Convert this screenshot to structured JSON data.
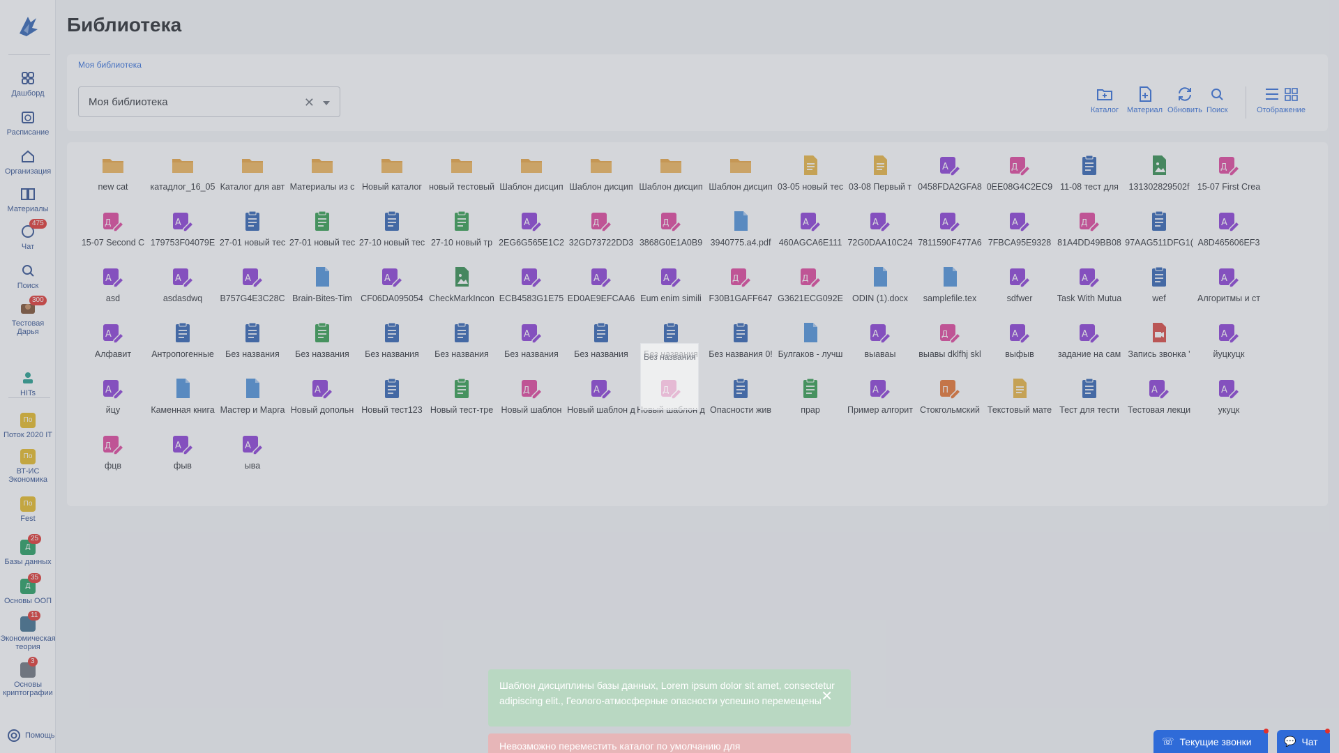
{
  "page_title": "Библиотека",
  "breadcrumb": "Моя библиотека",
  "library_select": {
    "value": "Моя библиотека"
  },
  "toolbar": {
    "catalog": "Каталог",
    "material": "Материал",
    "refresh": "Обновить",
    "search": "Поиск",
    "display": "Отображение"
  },
  "sidebar": {
    "items": [
      {
        "label": "Дашборд",
        "icon": "dashboard-icon"
      },
      {
        "label": "Расписание",
        "icon": "schedule-icon"
      },
      {
        "label": "Организация",
        "icon": "home-icon"
      },
      {
        "label": "Материалы",
        "icon": "book-icon"
      },
      {
        "label": "Чат",
        "icon": "chat-icon",
        "badge": "475"
      },
      {
        "label": "Поиск",
        "icon": "search-icon"
      },
      {
        "label": "Тестовая Дарья",
        "icon": "avatar-icon",
        "badge": "300"
      },
      {
        "label": "HITs",
        "icon": "hits-logo"
      }
    ],
    "courses": [
      {
        "label": "Поток 2020 IT",
        "abbr": "По",
        "color": "#e6b91e"
      },
      {
        "label": "ВТ-ИС Экономика",
        "abbr": "По",
        "color": "#e6b91e"
      },
      {
        "label": "Fest",
        "abbr": "По",
        "color": "#e6b91e"
      },
      {
        "label": "Базы данных",
        "abbr": "Д",
        "color": "#1e9b5a",
        "badge": "25"
      },
      {
        "label": "Основы ООП",
        "abbr": "Д",
        "color": "#1e9b5a",
        "badge": "35"
      },
      {
        "label": "Экономическая теория",
        "abbr": "",
        "color": "#3a6a8a",
        "badge": "11"
      },
      {
        "label": "Основы криптографии",
        "abbr": "",
        "color": "#6b7079",
        "badge": "3"
      }
    ],
    "help": "Помощь"
  },
  "files": [
    {
      "name": "new cat",
      "type": "folder"
    },
    {
      "name": "катадлог_16_05",
      "type": "folder"
    },
    {
      "name": "Каталог для авт",
      "type": "folder"
    },
    {
      "name": "Материалы из с",
      "type": "folder"
    },
    {
      "name": "Новый каталог",
      "type": "folder"
    },
    {
      "name": "новый тестовый",
      "type": "folder"
    },
    {
      "name": "Шаблон дисцип",
      "type": "folder"
    },
    {
      "name": "Шаблон дисцип",
      "type": "folder"
    },
    {
      "name": "Шаблон дисцип",
      "type": "folder"
    },
    {
      "name": "Шаблон дисцип",
      "type": "folder"
    },
    {
      "name": "03-05 новый тес",
      "type": "doc-yellow"
    },
    {
      "name": "03-08 Первый т",
      "type": "doc-yellow"
    },
    {
      "name": "0458FDA2GFA8",
      "type": "task-purple"
    },
    {
      "name": "0EE08G4C2EC9",
      "type": "task-pink"
    },
    {
      "name": "11-08 тест для",
      "type": "test-blue"
    },
    {
      "name": "131302829502f",
      "type": "image-green"
    },
    {
      "name": "15-07 First Crea",
      "type": "task-pink"
    },
    {
      "name": "15-07 Second C",
      "type": "task-pink"
    },
    {
      "name": "179753F04079E",
      "type": "task-purple"
    },
    {
      "name": "27-01 новый тес",
      "type": "test-blue"
    },
    {
      "name": "27-01 новый тес",
      "type": "test-green"
    },
    {
      "name": "27-10 новый тес",
      "type": "test-blue"
    },
    {
      "name": "27-10 новый тр",
      "type": "test-green"
    },
    {
      "name": "2EG6G565E1C2",
      "type": "task-purple"
    },
    {
      "name": "32GD73722DD3",
      "type": "task-pink"
    },
    {
      "name": "3868G0E1A0B9",
      "type": "task-pink"
    },
    {
      "name": "3940775.a4.pdf",
      "type": "file-blue"
    },
    {
      "name": "460AGCA6E111",
      "type": "task-purple"
    },
    {
      "name": "72G0DAA10C24",
      "type": "task-purple"
    },
    {
      "name": "7811590F477A6",
      "type": "task-purple"
    },
    {
      "name": "7FBCA95E9328",
      "type": "task-purple"
    },
    {
      "name": "81A4DD49BB08",
      "type": "task-pink"
    },
    {
      "name": "97AAG511DFG1(",
      "type": "test-blue"
    },
    {
      "name": "A8D465606EF3",
      "type": "task-purple"
    },
    {
      "name": "asd",
      "type": "task-purple"
    },
    {
      "name": "asdasdwq",
      "type": "task-purple"
    },
    {
      "name": "B757G4E3C28C",
      "type": "task-purple"
    },
    {
      "name": "Brain-Bites-Tim",
      "type": "file-blue"
    },
    {
      "name": "CF06DA095054",
      "type": "task-purple"
    },
    {
      "name": "CheckMarkIncon",
      "type": "image-green"
    },
    {
      "name": "ECB4583G1E75",
      "type": "task-purple"
    },
    {
      "name": "ED0AE9EFCAA6",
      "type": "task-purple"
    },
    {
      "name": "Eum enim simili",
      "type": "task-purple"
    },
    {
      "name": "F30B1GAFF647",
      "type": "task-pink"
    },
    {
      "name": "G3621ECG092E",
      "type": "task-pink"
    },
    {
      "name": "ODIN (1).docx",
      "type": "file-blue"
    },
    {
      "name": "samplefile.tex",
      "type": "file-blue"
    },
    {
      "name": "sdfwer",
      "type": "task-purple"
    },
    {
      "name": "Task With Mutua",
      "type": "task-purple"
    },
    {
      "name": "wef",
      "type": "test-blue"
    },
    {
      "name": "Алгоритмы и ст",
      "type": "task-purple"
    },
    {
      "name": "Алфавит",
      "type": "task-purple"
    },
    {
      "name": "Антропогенные",
      "type": "test-blue"
    },
    {
      "name": "Без названия",
      "type": "test-blue"
    },
    {
      "name": "Без названия",
      "type": "test-green"
    },
    {
      "name": "Без названия",
      "type": "test-blue"
    },
    {
      "name": "Без названия",
      "type": "test-blue"
    },
    {
      "name": "Без названия",
      "type": "task-purple"
    },
    {
      "name": "Без названия",
      "type": "test-blue"
    },
    {
      "name": "Без названия",
      "type": "test-blue"
    },
    {
      "name": "Без названия 0!",
      "type": "test-blue"
    },
    {
      "name": "Булгаков - лучш",
      "type": "file-blue"
    },
    {
      "name": "выаваы",
      "type": "task-purple"
    },
    {
      "name": "выавы dklfhj skl",
      "type": "task-pink"
    },
    {
      "name": "выфыв",
      "type": "task-purple"
    },
    {
      "name": "задание на сам",
      "type": "task-purple"
    },
    {
      "name": "Запись звонка '",
      "type": "video-red"
    },
    {
      "name": "йуцкуцк",
      "type": "task-purple"
    },
    {
      "name": "йцу",
      "type": "task-purple"
    },
    {
      "name": "Каменная книга",
      "type": "file-blue"
    },
    {
      "name": "Мастер и Марга",
      "type": "file-blue"
    },
    {
      "name": "Новый допольн",
      "type": "task-purple"
    },
    {
      "name": "Новый тест123",
      "type": "test-blue"
    },
    {
      "name": "Новый тест-тре",
      "type": "test-green"
    },
    {
      "name": "Новый шаблон",
      "type": "task-pink"
    },
    {
      "name": "Новый шаблон д",
      "type": "task-purple"
    },
    {
      "name": "Новый шаблон д",
      "type": "task-pink"
    },
    {
      "name": "Опасности жив",
      "type": "test-blue"
    },
    {
      "name": "прар",
      "type": "test-green"
    },
    {
      "name": "Пример алгорит",
      "type": "task-purple"
    },
    {
      "name": "Стокгольмский",
      "type": "pres-orange"
    },
    {
      "name": "Текстовый мате",
      "type": "doc-yellow"
    },
    {
      "name": "Тест для тести",
      "type": "test-blue"
    },
    {
      "name": "Тестовая лекци",
      "type": "task-purple"
    },
    {
      "name": "укуцк",
      "type": "task-purple"
    },
    {
      "name": "фцв",
      "type": "task-pink"
    },
    {
      "name": "фыв",
      "type": "task-purple"
    },
    {
      "name": "ыва",
      "type": "task-purple"
    }
  ],
  "drag_ghost_label": "Без названия",
  "toast_success": {
    "text": "Шаблон дисциплины базы данных, Lorem ipsum dolor sit amet, consectetur adipiscing elit., Геолого-атмосферные опасности успешно перемещены"
  },
  "toast_error": {
    "text": "Невозможно переместить каталог по умолчанию для"
  },
  "bottom": {
    "calls": "Текущие звонки",
    "chat": "Чат"
  },
  "colors": {
    "accent": "#2f6bd8",
    "folder": "#e9a23b",
    "purple": "#8a3ad6",
    "pink": "#e0409a",
    "blue": "#2b5fb0",
    "green": "#2e9b4a"
  }
}
